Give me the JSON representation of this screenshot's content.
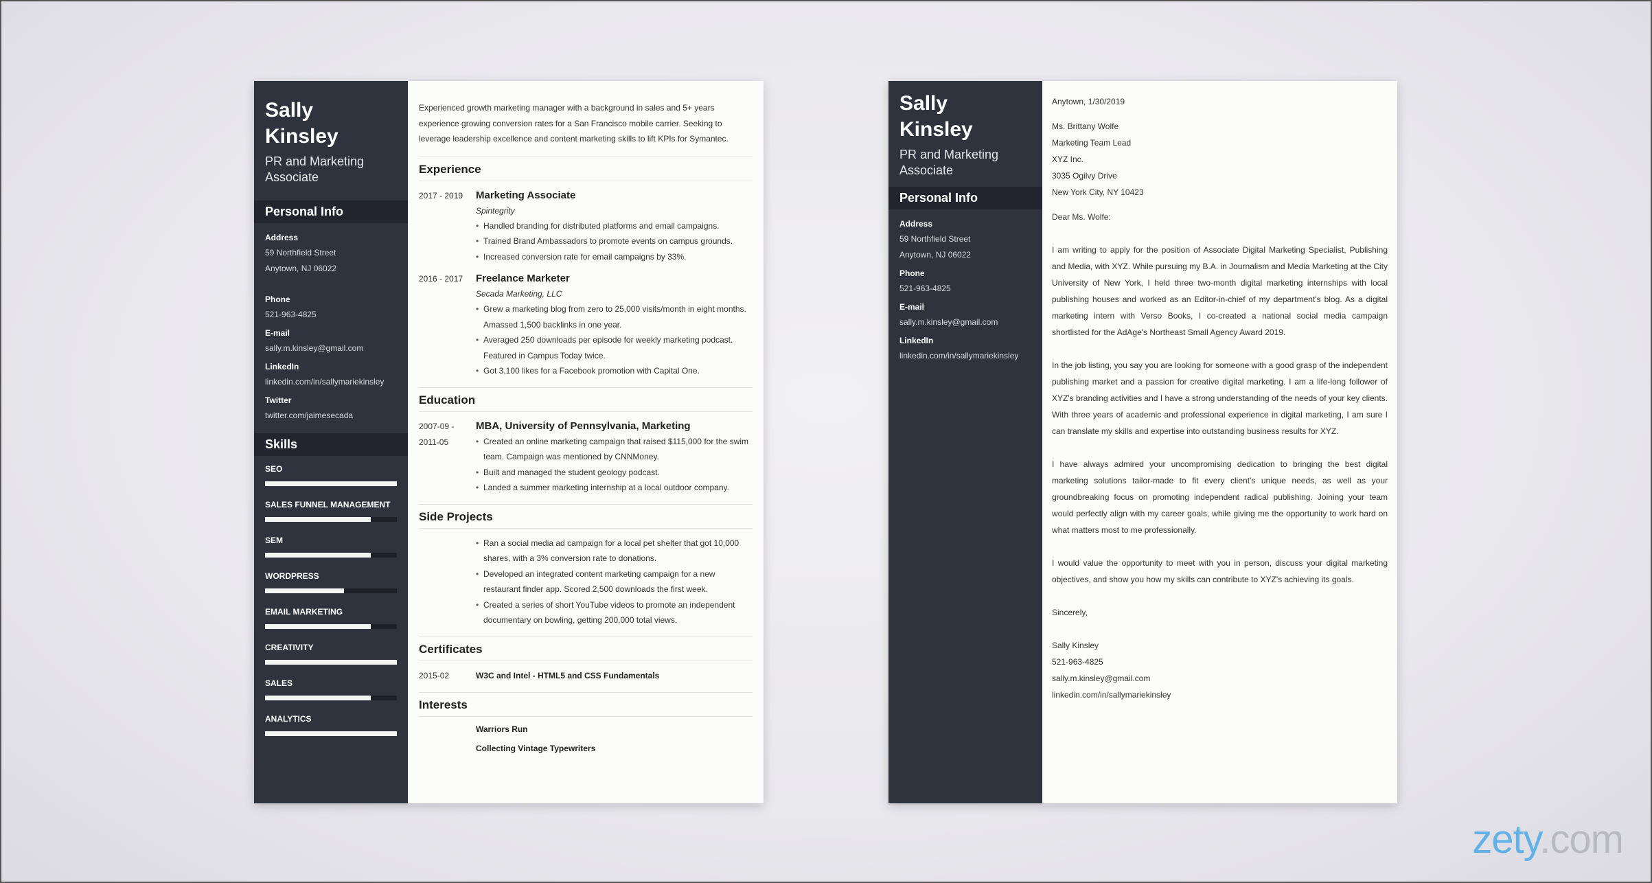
{
  "resume": {
    "name_first": "Sally",
    "name_last": "Kinsley",
    "role": "PR and Marketing Associate",
    "personal_info_heading": "Personal Info",
    "address_label": "Address",
    "address_line1": "59 Northfield Street",
    "address_line2": "Anytown, NJ 06022",
    "phone_label": "Phone",
    "phone": "521-963-4825",
    "email_label": "E-mail",
    "email": "sally.m.kinsley@gmail.com",
    "linkedin_label": "LinkedIn",
    "linkedin": "linkedin.com/in/sallymariekinsley",
    "twitter_label": "Twitter",
    "twitter": "twitter.com/jaimesecada",
    "skills_heading": "Skills",
    "skills": [
      {
        "name": "SEO",
        "level": 1.0
      },
      {
        "name": "SALES FUNNEL MANAGEMENT",
        "level": 0.8
      },
      {
        "name": "SEM",
        "level": 0.8
      },
      {
        "name": "WORDPRESS",
        "level": 0.6
      },
      {
        "name": "EMAIL MARKETING",
        "level": 0.8
      },
      {
        "name": "CREATIVITY",
        "level": 1.0
      },
      {
        "name": "SALES",
        "level": 0.8
      },
      {
        "name": "ANALYTICS",
        "level": 1.0
      }
    ],
    "summary": "Experienced growth marketing manager with a background in sales and 5+ years experience growing conversion rates for a San Francisco mobile carrier. Seeking to leverage leadership excellence and content marketing skills to lift KPIs for Symantec.",
    "experience_heading": "Experience",
    "experience": [
      {
        "date": "2017 - 2019",
        "title": "Marketing Associate",
        "org": "Spintegrity",
        "bullets": [
          "Handled branding for distributed platforms and email campaigns.",
          "Trained Brand Ambassadors to promote events on campus grounds.",
          "Increased conversion rate for email campaigns by 33%."
        ]
      },
      {
        "date": "2016 - 2017",
        "title": "Freelance Marketer",
        "org": "Secada Marketing, LLC",
        "bullets": [
          "Grew a marketing blog from zero to 25,000 visits/month in eight months. Amassed 1,500 backlinks in one year.",
          "Averaged 250 downloads per episode for weekly marketing podcast. Featured in Campus Today twice.",
          "Got 3,100 likes for a Facebook promotion with Capital One."
        ]
      }
    ],
    "education_heading": "Education",
    "education": [
      {
        "date": "2007-09 - 2011-05",
        "title": "MBA, University of Pennsylvania, Marketing",
        "bullets": [
          "Created an online marketing campaign that raised $115,000 for the swim team. Campaign was mentioned by CNNMoney.",
          "Built and managed the student geology podcast.",
          "Landed a summer marketing internship at a local outdoor company."
        ]
      }
    ],
    "side_projects_heading": "Side Projects",
    "side_projects": [
      "Ran a social media ad campaign for a local pet shelter that got 10,000 shares, with a 3% conversion rate to donations.",
      "Developed an integrated content marketing campaign for a new restaurant finder app. Scored 2,500 downloads the first week.",
      "Created a series of short YouTube videos to promote an independent documentary on bowling, getting 200,000 total views."
    ],
    "certificates_heading": "Certificates",
    "certificates": [
      {
        "date": "2015-02",
        "title": "W3C and Intel - HTML5 and CSS Fundamentals"
      }
    ],
    "interests_heading": "Interests",
    "interests": [
      "Warriors Run",
      "Collecting Vintage Typewriters"
    ]
  },
  "cover_letter": {
    "name_first": "Sally",
    "name_last": "Kinsley",
    "role": "PR and Marketing Associate",
    "personal_info_heading": "Personal Info",
    "address_label": "Address",
    "address_line1": "59 Northfield Street",
    "address_line2": "Anytown, NJ 06022",
    "phone_label": "Phone",
    "phone": "521-963-4825",
    "email_label": "E-mail",
    "email": "sally.m.kinsley@gmail.com",
    "linkedin_label": "LinkedIn",
    "linkedin": "linkedin.com/in/sallymariekinsley",
    "place_date": "Anytown, 1/30/2019",
    "recipient": [
      "Ms. Brittany Wolfe",
      "Marketing Team Lead",
      "XYZ Inc.",
      "3035 Ogilvy Drive",
      "New York City, NY 10423"
    ],
    "salutation": "Dear Ms. Wolfe:",
    "paragraphs": [
      "I am writing to apply for the position of Associate Digital Marketing Specialist, Publishing and Media, with XYZ. While pursuing my B.A. in Journalism and Media Marketing at the City University of New York, I held three two-month digital marketing internships with local publishing houses and worked as an Editor-in-chief of my department's blog. As a digital marketing intern with Verso Books, I co-created a national social media campaign shortlisted for the AdAge's Northeast Small Agency Award 2019.",
      "In the job listing, you say you are looking for someone with a good grasp of the independent publishing market and a passion for creative digital marketing. I am a life-long follower of XYZ's branding activities and I have a strong understanding of the needs of your key clients. With three years of academic and professional experience in digital marketing, I am sure I can translate my skills and expertise into outstanding business results for XYZ.",
      "I have always admired your uncompromising dedication to bringing the best digital marketing solutions tailor-made to fit every client's unique needs, as well as your groundbreaking focus on promoting independent radical publishing. Joining your team would perfectly align with my career goals, while giving me the opportunity to work hard on what matters most to me professionally.",
      "I would value the opportunity to meet with you in person, discuss your digital marketing objectives, and show you how my skills can contribute to XYZ's achieving its goals."
    ],
    "closing": "Sincerely,",
    "signature": [
      "Sally Kinsley",
      "521-963-4825",
      "sally.m.kinsley@gmail.com",
      "linkedin.com/in/sallymariekinsley"
    ]
  },
  "brand": {
    "part1": "zety",
    "part2": ".com",
    "color_primary": "#62b1e6",
    "color_secondary": "#b9babd"
  },
  "colors": {
    "sidebar": "#2f333d",
    "sidebar_header": "#22252d",
    "paper": "#fbfbf9"
  }
}
